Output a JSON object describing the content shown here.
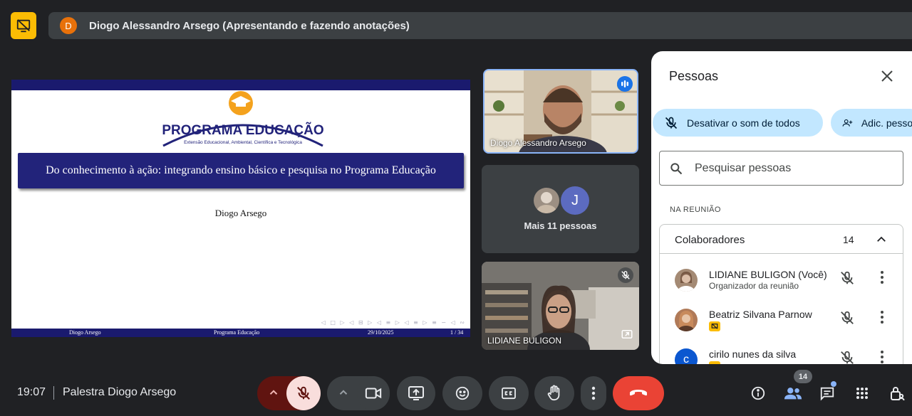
{
  "header": {
    "presenter_initial": "D",
    "presenter_text": "Diogo Alessandro Arsego (Apresentando e fazendo anotações)"
  },
  "slide": {
    "logo_title": "PROGRAMA EDUCAÇÃO",
    "logo_subtitle": "Extensão Educacional, Ambiental, Científica e Tecnológica",
    "title": "Do conhecimento à ação: integrando ensino básico e pesquisa no Programa Educação",
    "author": "Diogo Arsego",
    "footer": {
      "author": "Diogo Arsego",
      "program": "Programa Educação",
      "date": "29/10/2025",
      "page": "1 / 34"
    }
  },
  "tiles": {
    "diogo_name": "Diogo Alessandro Arsego",
    "more_avatar_initial": "J",
    "more_label": "Mais 11 pessoas",
    "lidiane_name": "LIDIANE BULIGON"
  },
  "people_panel": {
    "title": "Pessoas",
    "mute_all_label": "Desativar o som de todos",
    "add_people_label": "Adic. pessoas",
    "search_placeholder": "Pesquisar pessoas",
    "section_label": "NA REUNIÃO",
    "group_label": "Colaboradores",
    "group_count": "14",
    "participants": [
      {
        "name": "LIDIANE BULIGON (Você)",
        "subtitle": "Organizador da reunião"
      },
      {
        "name": "Beatriz Silvana Parnow",
        "subtitle": ""
      },
      {
        "name": "cirilo nunes da silva",
        "subtitle": "",
        "initial": "c"
      }
    ]
  },
  "bottom_bar": {
    "time": "19:07",
    "meeting_name": "Palestra Diogo Arsego",
    "people_count": "14"
  },
  "colors": {
    "background": "#202124",
    "accent_blue": "#8ab4f8",
    "leave_red": "#ea4335",
    "mic_muted_bg": "#f9dedc",
    "slide_navy": "#1a1a6e",
    "panel_pill": "#c2e7ff",
    "presenting_yellow": "#fbbc04"
  }
}
